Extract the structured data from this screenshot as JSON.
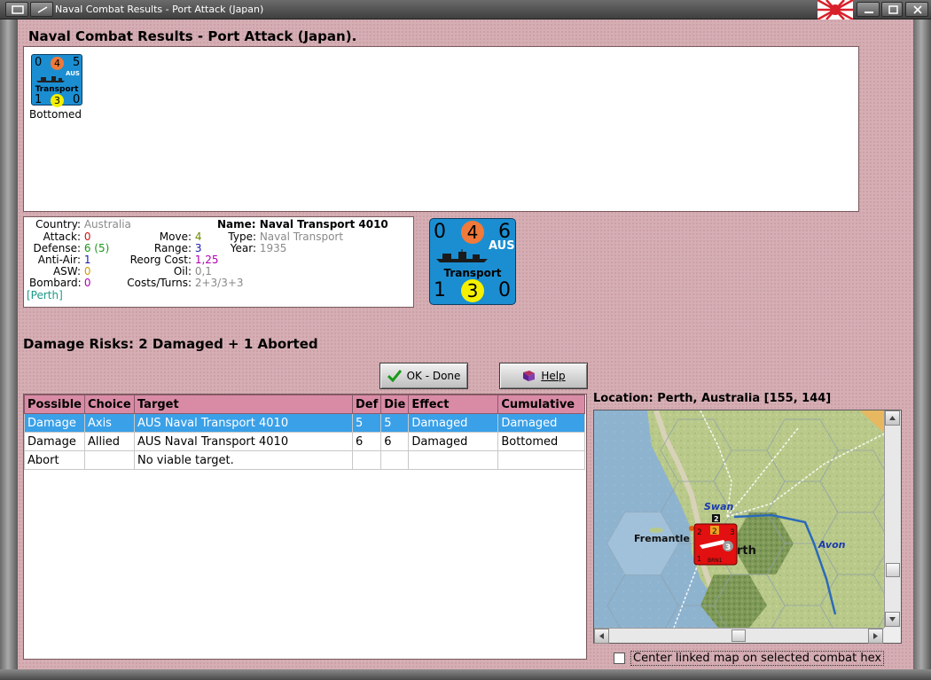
{
  "window": {
    "title": "Naval Combat Results - Port Attack (Japan)"
  },
  "heading": "Naval Combat Results - Port Attack (Japan).",
  "unit_list": [
    {
      "counter": {
        "top_left": "0",
        "top_circle": "4",
        "top_right": "5",
        "nationality": "AUS",
        "type_label": "Transport",
        "bottom_left": "1",
        "bottom_circle": "3",
        "bottom_right": "0"
      },
      "status": "Bottomed"
    }
  ],
  "unit_info": {
    "country_label": "Country:",
    "country": "Australia",
    "attack_label": "Attack:",
    "attack": "0",
    "defense_label": "Defense:",
    "defense": "6 (5)",
    "anti_air_label": "Anti-Air:",
    "anti_air": "1",
    "asw_label": "ASW:",
    "asw": "0",
    "bombard_label": "Bombard:",
    "bombard": "0",
    "location": "[Perth]",
    "move_label": "Move:",
    "move": "4",
    "range_label": "Range:",
    "range": "3",
    "reorg_label": "Reorg Cost:",
    "reorg": "1,25",
    "oil_label": "Oil:",
    "oil": "0,1",
    "costs_label": "Costs/Turns:",
    "costs": "2+3/3+3",
    "name_label": "Name:",
    "name": "Naval Transport 4010",
    "type_label": "Type:",
    "type": "Naval Transport",
    "year_label": "Year:",
    "year": "1935"
  },
  "big_counter": {
    "top_left": "0",
    "top_circle": "4",
    "top_right": "6",
    "nationality": "AUS",
    "type_label": "Transport",
    "bottom_left": "1",
    "bottom_circle": "3",
    "bottom_right": "0"
  },
  "damage_risks": "Damage Risks:  2 Damaged + 1 Aborted",
  "buttons": {
    "ok": "OK - Done",
    "help": "Help"
  },
  "table": {
    "headers": [
      "Possible",
      "Choice",
      "Target",
      "Def",
      "Die",
      "Effect",
      "Cumulative"
    ],
    "rows": [
      [
        "Damage",
        "Axis",
        "AUS Naval Transport 4010",
        "5",
        "5",
        "Damaged",
        "Damaged"
      ],
      [
        "Damage",
        "Allied",
        "AUS Naval Transport 4010",
        "6",
        "6",
        "Damaged",
        "Bottomed"
      ],
      [
        "Abort",
        "",
        "No viable target.",
        "",
        "",
        "",
        ""
      ]
    ]
  },
  "location": "Location:  Perth, Australia [155, 144]",
  "map_labels": {
    "swan": "Swan",
    "fremantle": "Fremantle",
    "perth": "rth",
    "avon": "Avon",
    "unit_top": "2",
    "unit_mid": "2",
    "unit_side": "3",
    "unit_br": "3",
    "unit_bl": "1",
    "unit_code": "BRN1",
    "stack_count": "2"
  },
  "checkbox": {
    "label": "Center linked map on selected combat hex",
    "checked": false
  },
  "colors": {
    "counter_blue": "#1b8ed2",
    "attack_circle": "#f07a3a",
    "defense_circle": "#f4f000",
    "header_pink": "#d98ba6",
    "selected_row": "#3aa0e8"
  }
}
